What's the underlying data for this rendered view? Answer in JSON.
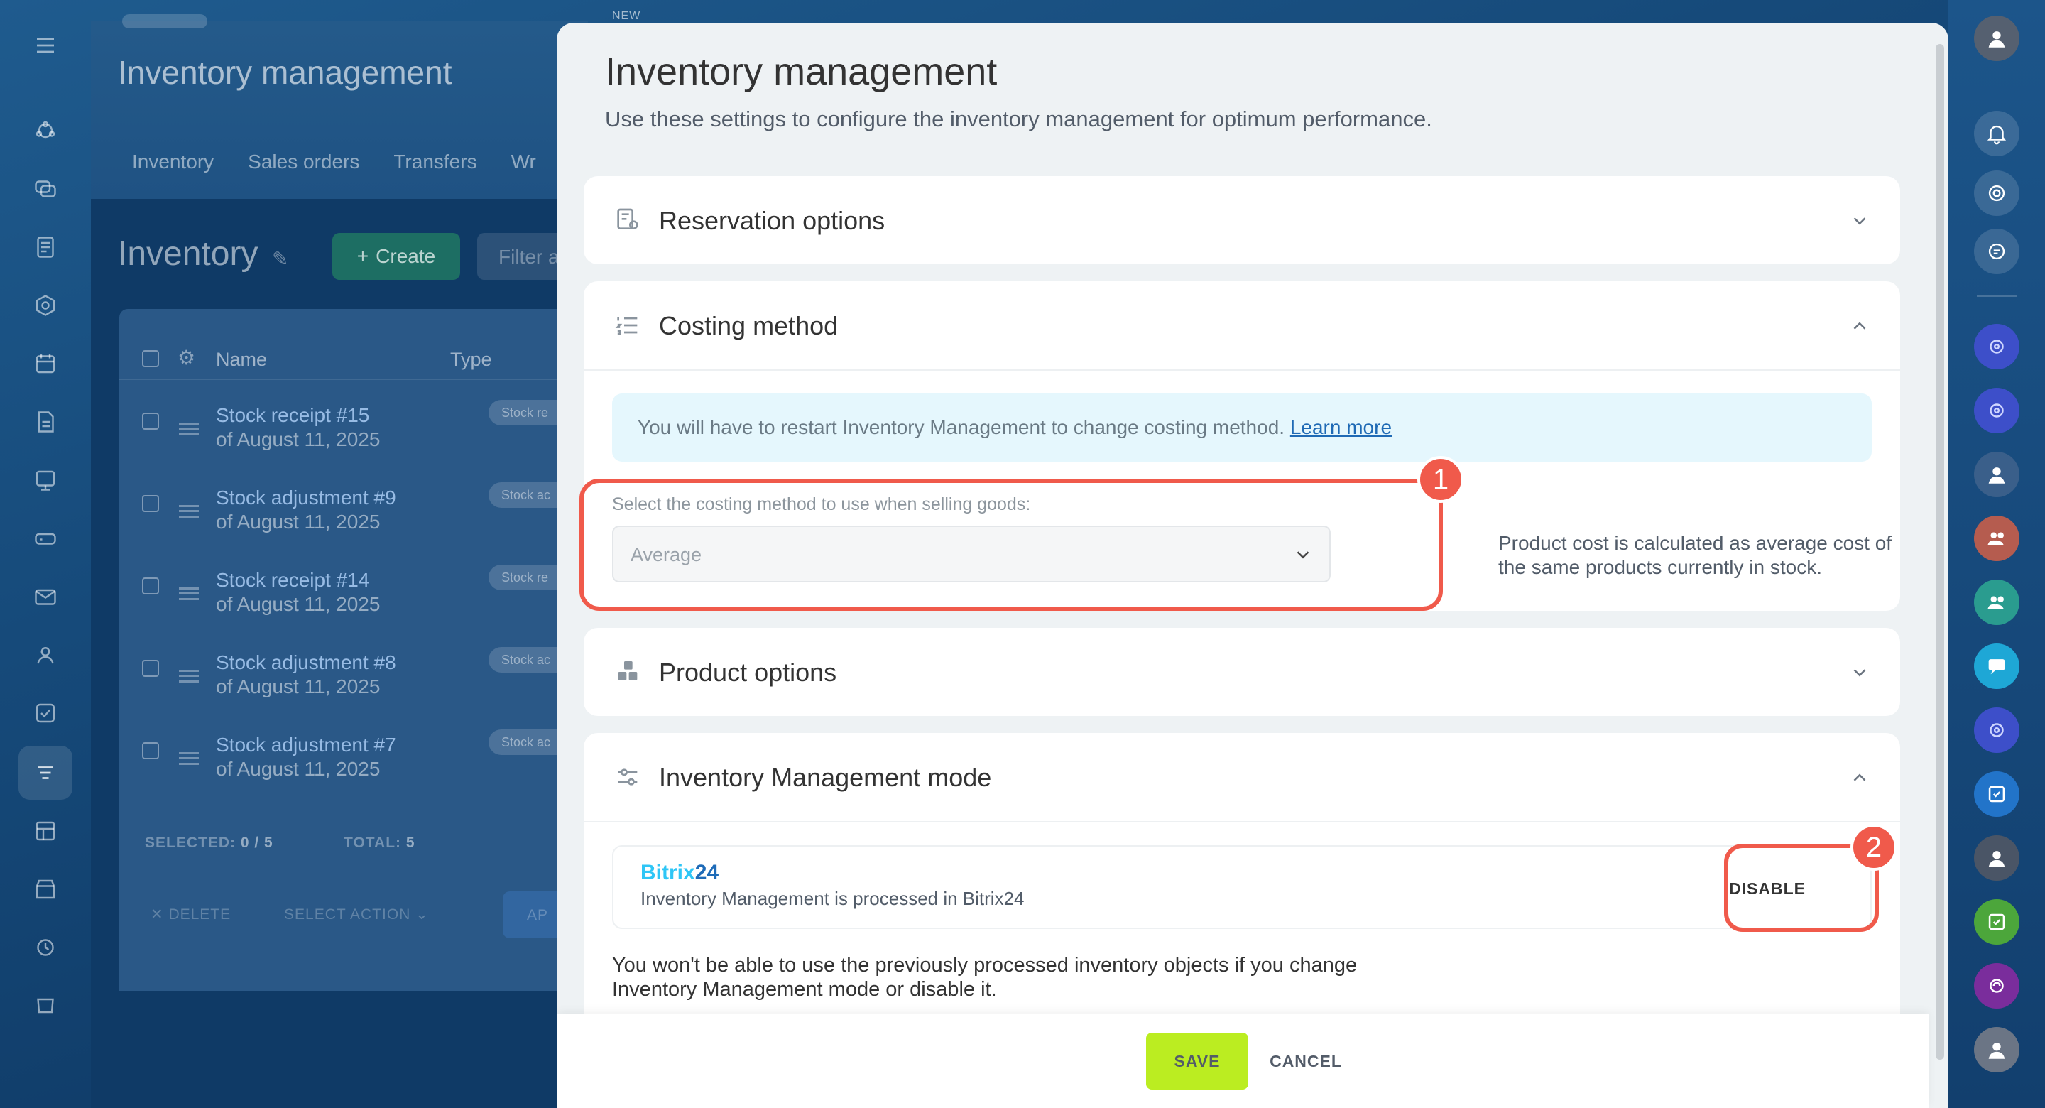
{
  "background": {
    "title": "Inventory management",
    "tabs": [
      "Inventory",
      "Sales orders",
      "Transfers",
      "Wr"
    ],
    "inventory_title": "Inventory",
    "create_label": "Create",
    "filter_placeholder": "Filter a",
    "columns": {
      "name": "Name",
      "type": "Type"
    },
    "rows": [
      {
        "title": "Stock receipt #15",
        "date": "of August 11, 2025",
        "badge": "Stock re"
      },
      {
        "title": "Stock adjustment #9",
        "date": "of August 11, 2025",
        "badge": "Stock ac"
      },
      {
        "title": "Stock receipt #14",
        "date": "of August 11, 2025",
        "badge": "Stock re"
      },
      {
        "title": "Stock adjustment #8",
        "date": "of August 11, 2025",
        "badge": "Stock ac"
      },
      {
        "title": "Stock adjustment #7",
        "date": "of August 11, 2025",
        "badge": "Stock ac"
      }
    ],
    "footer": {
      "selected_label": "SELECTED:",
      "selected_value": "0 / 5",
      "total_label": "TOTAL:",
      "total_value": "5"
    },
    "actions": {
      "delete": "DELETE",
      "select_action": "SELECT ACTION",
      "apply": "AP"
    }
  },
  "slider_label": "NEW",
  "panel": {
    "title": "Inventory management",
    "subtitle": "Use these settings to configure the inventory management for optimum performance.",
    "sections": {
      "reservation": {
        "title": "Reservation options"
      },
      "costing": {
        "title": "Costing method",
        "info_text": "You will have to restart Inventory Management to change costing method. ",
        "learn_more": "Learn more",
        "field_label": "Select the costing method to use when selling goods:",
        "selected_value": "Average",
        "hint": "Product cost is calculated as average cost of the same products currently in stock."
      },
      "product": {
        "title": "Product options"
      },
      "mode": {
        "title": "Inventory Management mode",
        "brand_part1": "Bitrix",
        "brand_part2": "24",
        "description": "Inventory Management is processed in Bitrix24",
        "disable_label": "DISABLE",
        "warning": "You won't be able to use the previously processed inventory objects if you change Inventory Management mode or disable it."
      }
    },
    "footer": {
      "save_label": "SAVE",
      "cancel_label": "CANCEL"
    }
  },
  "markers": [
    "1",
    "2"
  ],
  "colors": {
    "accent_red": "#f05a4b",
    "save_green": "#bbed21",
    "link_blue": "#1f6ab5"
  }
}
